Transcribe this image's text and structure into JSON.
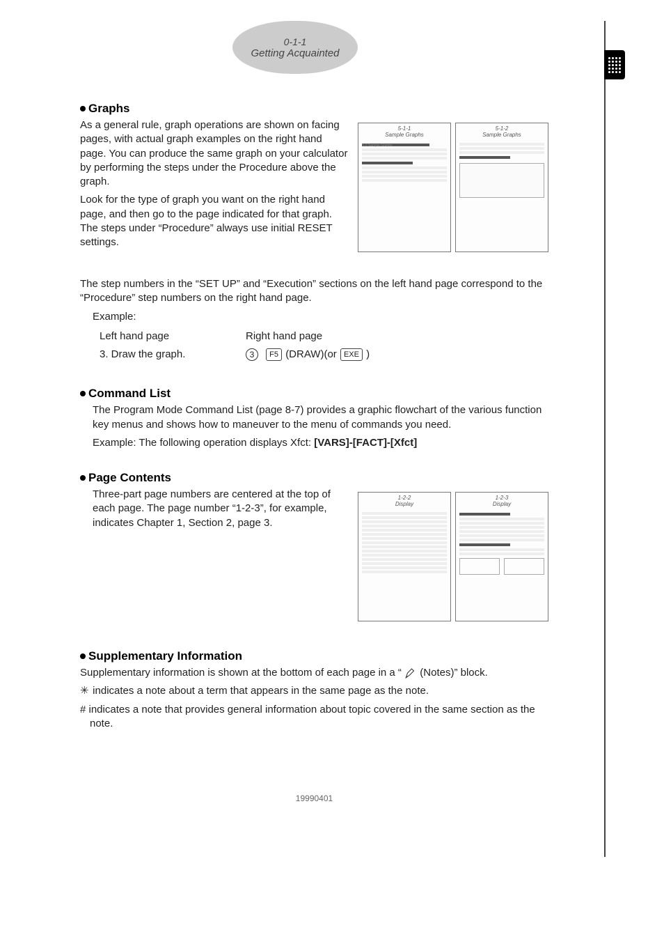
{
  "header": {
    "page_number": "0-1-1",
    "title": "Getting Acquainted"
  },
  "graphs": {
    "heading": "Graphs",
    "p1": "As a general rule, graph operations are shown on facing pages, with actual graph examples on the right hand page. You can produce the same graph on your calculator by performing the steps under the Procedure above the graph.",
    "p2": "Look for the type of graph you want on the right hand page, and then go to the page indicated for that graph. The steps under “Procedure” always use initial RESET settings.",
    "p3": "The step numbers in the “SET UP” and “Execution” sections on the left hand page correspond to the “Procedure” step numbers on the right hand page.",
    "example_label": "Example:",
    "left_label": "Left hand page",
    "right_label": "Right hand page",
    "left_line": "3. Draw the graph.",
    "right_circ": "3",
    "right_key1": "F5",
    "right_text1": "(DRAW)(or",
    "right_key2": "EXE",
    "right_text2": ")",
    "thumb_left_title_num": "5-1-1",
    "thumb_left_title": "Sample Graphs",
    "thumb_left_sec": "5-1 Sample Graphs",
    "thumb_right_title_num": "5-1-2",
    "thumb_right_title": "Sample Graphs"
  },
  "command_list": {
    "heading": "Command List",
    "p1": "The Program Mode Command List (page 8-7) provides a graphic flowchart of the various function key menus and shows how to maneuver to the menu of commands you need.",
    "p2_pre": "Example: The following operation displays Xfct: ",
    "p2_bold": "[VARS]-[FACT]-[Xfct]"
  },
  "page_contents": {
    "heading": "Page Contents",
    "p1": "Three-part page numbers are centered at the top of each page. The page number “1-2-3”, for example, indicates Chapter 1, Section 2, page 3.",
    "thumb_left_title_num": "1-2-2",
    "thumb_left_title": "Display",
    "thumb_right_title_num": "1-2-3",
    "thumb_right_title": "Display"
  },
  "supplementary": {
    "heading": "Supplementary Information",
    "p1_pre": "Supplementary information is shown at the bottom of each page in a “ ",
    "p1_post": " (Notes)” block.",
    "p2": "indicates a note about a term that appears in the same page as the note.",
    "p3": "# indicates a note that provides general information about topic covered in the same section as the note."
  },
  "footer_id": "19990401"
}
